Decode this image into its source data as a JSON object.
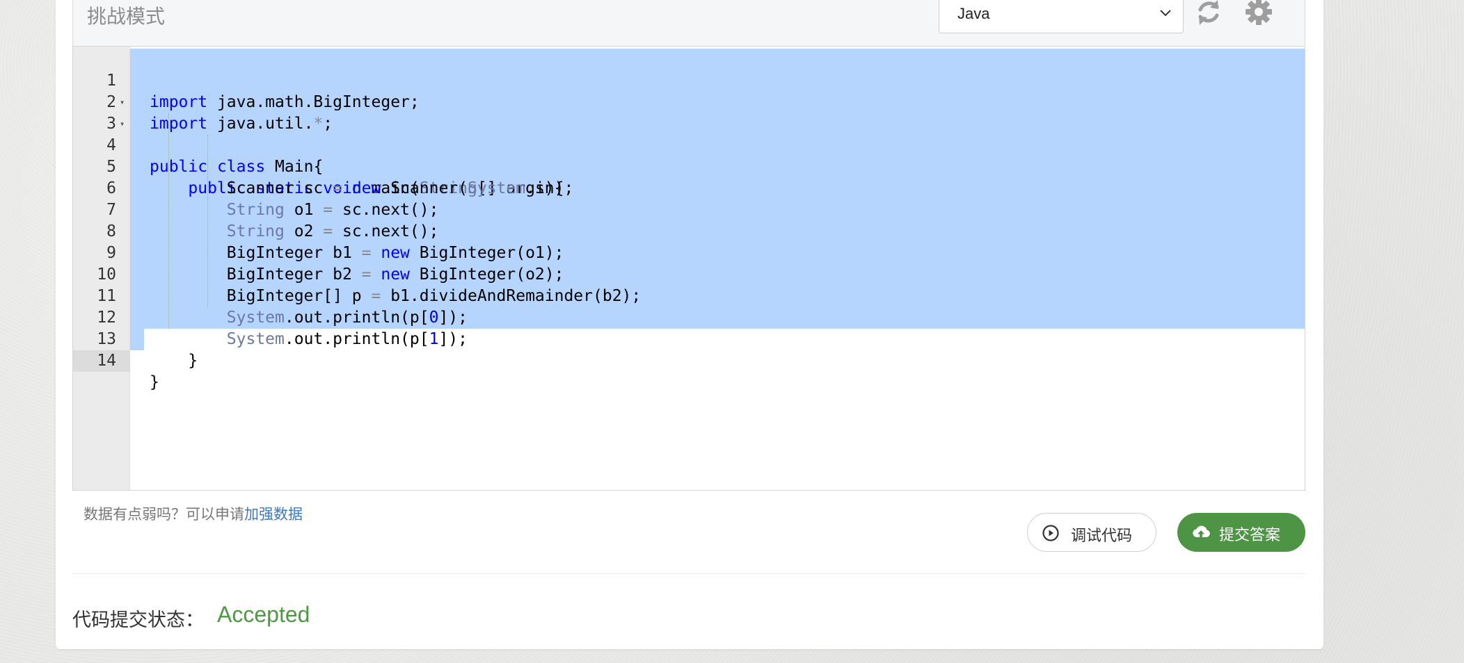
{
  "toolbar": {
    "mode_title": "挑战模式",
    "language": "Java"
  },
  "editor": {
    "line_numbers": [
      "1",
      "2",
      "3",
      "4",
      "5",
      "6",
      "7",
      "8",
      "9",
      "10",
      "11",
      "12",
      "13",
      "14"
    ],
    "code_lines": [
      "import java.math.BigInteger;",
      "import java.util.*;",
      "public class Main{",
      "    public static void main(String[] args){",
      "        Scanner sc = new Scanner(System.in);",
      "        String o1 = sc.next();",
      "        String o2 = sc.next();",
      "        BigInteger b1 = new BigInteger(o1);",
      "        BigInteger b2 = new BigInteger(o2);",
      "        BigInteger[] p = b1.divideAndRemainder(b2);",
      "        System.out.println(p[0]);",
      "        System.out.println(p[1]);",
      "    }",
      "}"
    ]
  },
  "footer": {
    "hint_prefix": "数据有点弱吗？可以申请",
    "hint_link": "加强数据",
    "debug_label": "调试代码",
    "submit_label": "提交答案"
  },
  "status": {
    "label": "代码提交状态：",
    "value": "Accepted"
  },
  "colors": {
    "accent_green": "#4d9545",
    "accepted_green": "#4c9a40",
    "selection": "#b5d5ff",
    "link_blue": "#3d78c0"
  }
}
